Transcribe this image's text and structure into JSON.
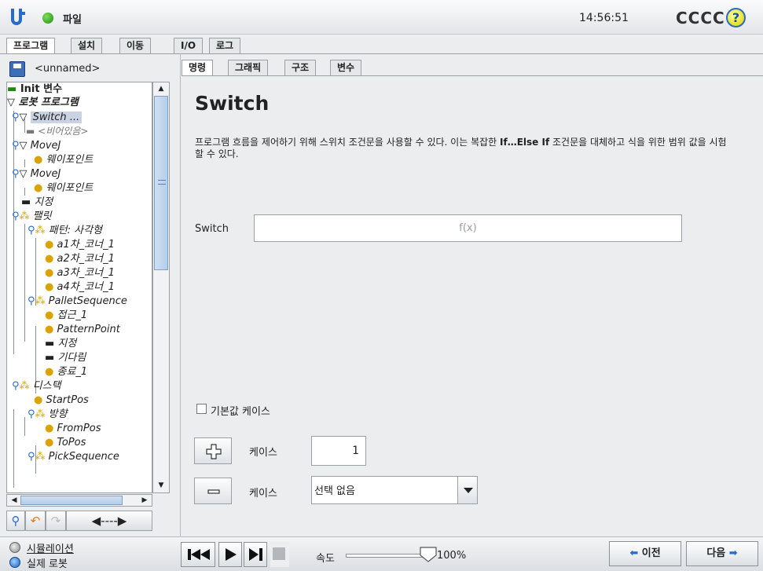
{
  "topbar": {
    "file_menu": "파일",
    "clock": "14:56:51",
    "robot_name": "CCCC",
    "help": "?"
  },
  "main_tabs": [
    "프로그램",
    "설치",
    "이동",
    "I/O",
    "로그"
  ],
  "left": {
    "program_name": "<unnamed>",
    "tree": [
      {
        "label": "Init 변수",
        "style": "bold"
      },
      {
        "label": "로봇 프로그램",
        "style": "bolditalic"
      },
      {
        "label": "Switch ...",
        "style": "selected"
      },
      {
        "label": "<비어있음>",
        "style": "grey"
      },
      {
        "label": "MoveJ"
      },
      {
        "label": "웨이포인트"
      },
      {
        "label": "MoveJ"
      },
      {
        "label": "웨이포인트"
      },
      {
        "label": "지정"
      },
      {
        "label": "팰릿"
      },
      {
        "label": "패턴: 사각형"
      },
      {
        "label": "a1차_코너_1"
      },
      {
        "label": "a2차_코너_1"
      },
      {
        "label": "a3차_코너_1"
      },
      {
        "label": "a4차_코너_1"
      },
      {
        "label": "PalletSequence"
      },
      {
        "label": "접근_1"
      },
      {
        "label": "PatternPoint"
      },
      {
        "label": "지정"
      },
      {
        "label": "기다림"
      },
      {
        "label": "종료_1"
      },
      {
        "label": "디스택"
      },
      {
        "label": "StartPos"
      },
      {
        "label": "방향"
      },
      {
        "label": "FromPos"
      },
      {
        "label": "ToPos"
      },
      {
        "label": "PickSequence"
      }
    ]
  },
  "sub_tabs": [
    "명령",
    "그래픽",
    "구조",
    "변수"
  ],
  "content": {
    "title": "Switch",
    "desc_part1": "프로그램 흐름을 제어하기 위해 스위치 조건문을 사용할 수 있다. 이는 복잡한 ",
    "desc_bold": "If…Else If",
    "desc_part2": " 조건문을 대체하고 식을 위한 범위 값을 시험할 수 있다.",
    "switch_label": "Switch",
    "expression_placeholder": "f(x)",
    "default_case_label": "기본값 케이스",
    "add_case_label": "케이스",
    "case_number": "1",
    "remove_case_label": "케이스",
    "remove_case_selected": "선택 없음"
  },
  "bottom": {
    "simulation": "시뮬레이션",
    "real_robot": "실제 로봇",
    "speed_label": "속도",
    "speed_value": "100%",
    "speed_fraction": 1.0,
    "prev": "이전",
    "next": "다음"
  },
  "colors": {
    "accent_blue": "#2a6bc7",
    "status_green": "#1f8a12",
    "arrow_orange": "#e07b20"
  }
}
